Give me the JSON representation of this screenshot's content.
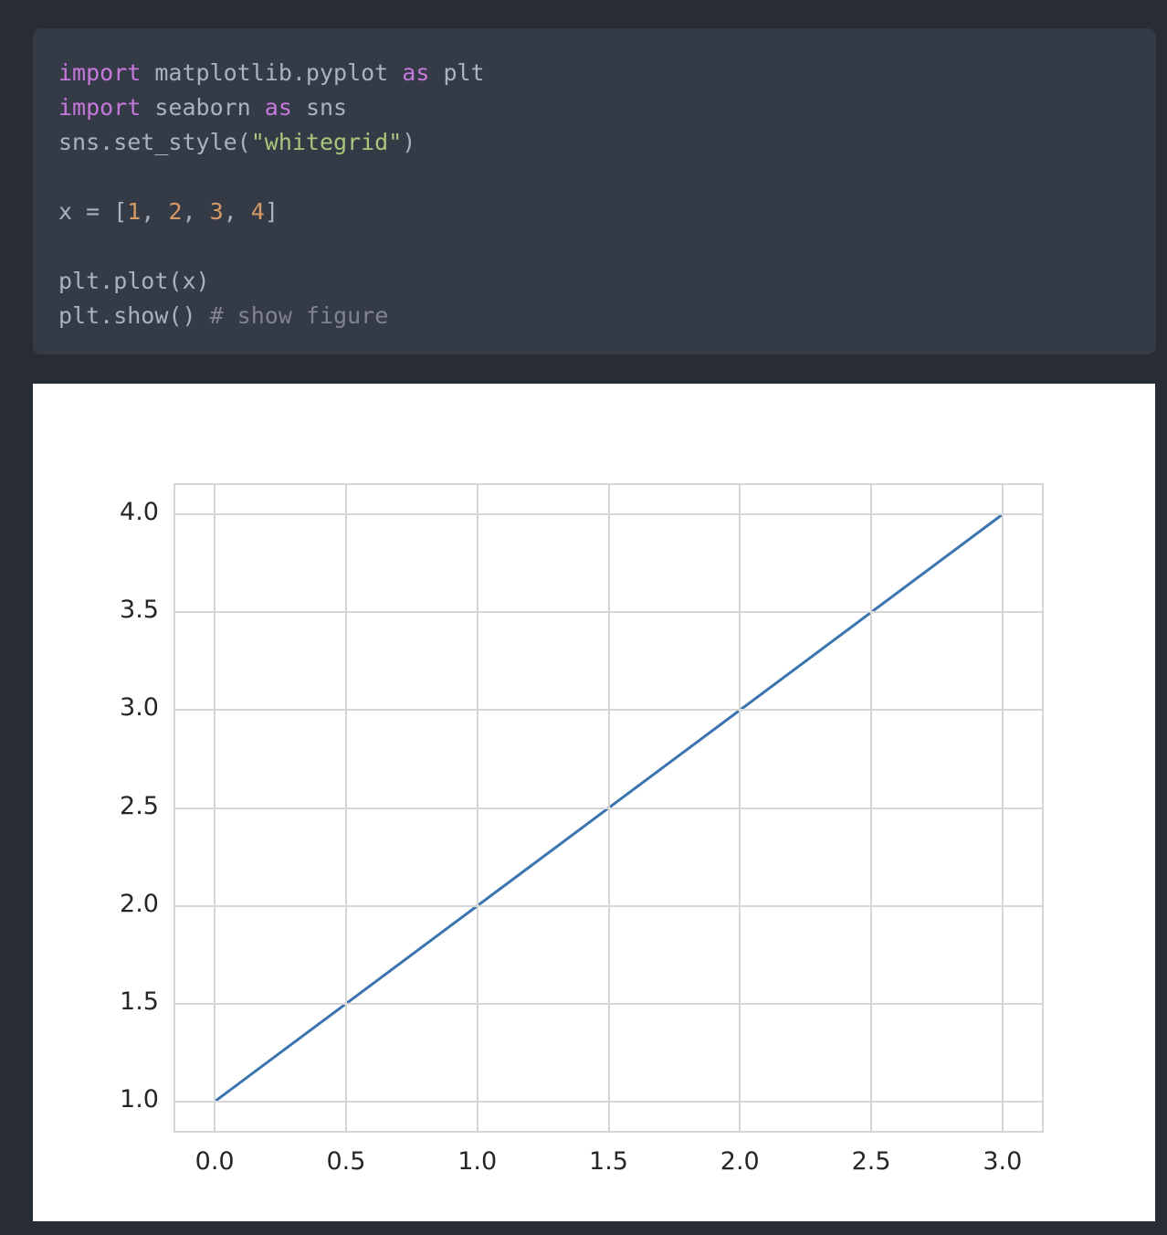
{
  "notebook": {
    "code_cell": {
      "language": "python",
      "lines": [
        [
          {
            "t": "import",
            "c": "kw"
          },
          {
            "t": " matplotlib.pyplot ",
            "c": "pln"
          },
          {
            "t": "as",
            "c": "kw"
          },
          {
            "t": " plt",
            "c": "pln"
          }
        ],
        [
          {
            "t": "import",
            "c": "kw"
          },
          {
            "t": " seaborn ",
            "c": "pln"
          },
          {
            "t": "as",
            "c": "kw"
          },
          {
            "t": " sns",
            "c": "pln"
          }
        ],
        [
          {
            "t": "sns.set_style(",
            "c": "pln"
          },
          {
            "t": "\"whitegrid\"",
            "c": "str"
          },
          {
            "t": ")",
            "c": "pln"
          }
        ],
        [],
        [
          {
            "t": "x = [",
            "c": "pln"
          },
          {
            "t": "1",
            "c": "num"
          },
          {
            "t": ", ",
            "c": "pln"
          },
          {
            "t": "2",
            "c": "num"
          },
          {
            "t": ", ",
            "c": "pln"
          },
          {
            "t": "3",
            "c": "num"
          },
          {
            "t": ", ",
            "c": "pln"
          },
          {
            "t": "4",
            "c": "num"
          },
          {
            "t": "]",
            "c": "pln"
          }
        ],
        [],
        [
          {
            "t": "plt.plot(x)",
            "c": "pln"
          }
        ],
        [
          {
            "t": "plt.show() ",
            "c": "pln"
          },
          {
            "t": "# show figure",
            "c": "cmt"
          }
        ]
      ]
    }
  },
  "colors": {
    "page_background": "#282c34",
    "code_background": "#343a46",
    "code_default_text": "#abb2bf",
    "code_keyword": "#c678dd",
    "code_string": "#a9c77c",
    "code_number": "#d79a66",
    "code_comment": "#7f848e",
    "figure_background": "#ffffff",
    "grid": "#d6d6d6",
    "line": "#3b75af",
    "tick_label": "#262626"
  },
  "chart_data": {
    "type": "line",
    "title": "",
    "xlabel": "",
    "ylabel": "",
    "x": [
      0,
      1,
      2,
      3
    ],
    "y": [
      1,
      2,
      3,
      4
    ],
    "series": [
      {
        "name": "x",
        "x": [
          0,
          1,
          2,
          3
        ],
        "values": [
          1,
          2,
          3,
          4
        ],
        "color": "#3b75af",
        "linewidth": 3
      }
    ],
    "xlim": [
      -0.15,
      3.15
    ],
    "ylim": [
      0.85,
      4.15
    ],
    "xticks": [
      0.0,
      0.5,
      1.0,
      1.5,
      2.0,
      2.5,
      3.0
    ],
    "xticklabels": [
      "0.0",
      "0.5",
      "1.0",
      "1.5",
      "2.0",
      "2.5",
      "3.0"
    ],
    "yticks": [
      1.0,
      1.5,
      2.0,
      2.5,
      3.0,
      3.5,
      4.0
    ],
    "yticklabels": [
      "1.0",
      "1.5",
      "2.0",
      "2.5",
      "3.0",
      "3.5",
      "4.0"
    ],
    "grid": true,
    "grid_axis": "both",
    "legend": null,
    "style": "whitegrid"
  }
}
